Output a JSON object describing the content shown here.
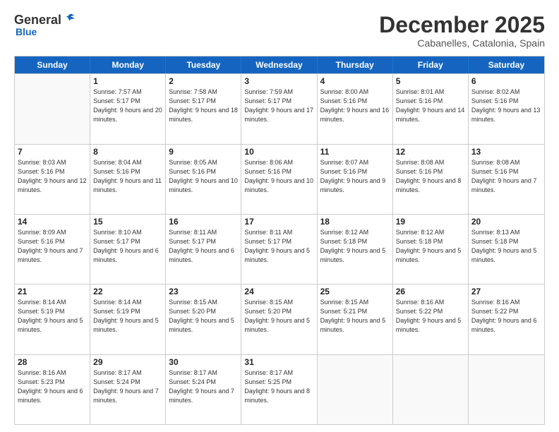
{
  "logo": {
    "general": "General",
    "blue": "Blue"
  },
  "title": "December 2025",
  "location": "Cabanelles, Catalonia, Spain",
  "days_of_week": [
    "Sunday",
    "Monday",
    "Tuesday",
    "Wednesday",
    "Thursday",
    "Friday",
    "Saturday"
  ],
  "weeks": [
    [
      {
        "day": "",
        "info": ""
      },
      {
        "day": "1",
        "info": "Sunrise: 7:57 AM\nSunset: 5:17 PM\nDaylight: 9 hours\nand 20 minutes."
      },
      {
        "day": "2",
        "info": "Sunrise: 7:58 AM\nSunset: 5:17 PM\nDaylight: 9 hours\nand 18 minutes."
      },
      {
        "day": "3",
        "info": "Sunrise: 7:59 AM\nSunset: 5:17 PM\nDaylight: 9 hours\nand 17 minutes."
      },
      {
        "day": "4",
        "info": "Sunrise: 8:00 AM\nSunset: 5:16 PM\nDaylight: 9 hours\nand 16 minutes."
      },
      {
        "day": "5",
        "info": "Sunrise: 8:01 AM\nSunset: 5:16 PM\nDaylight: 9 hours\nand 14 minutes."
      },
      {
        "day": "6",
        "info": "Sunrise: 8:02 AM\nSunset: 5:16 PM\nDaylight: 9 hours\nand 13 minutes."
      }
    ],
    [
      {
        "day": "7",
        "info": "Sunrise: 8:03 AM\nSunset: 5:16 PM\nDaylight: 9 hours\nand 12 minutes."
      },
      {
        "day": "8",
        "info": "Sunrise: 8:04 AM\nSunset: 5:16 PM\nDaylight: 9 hours\nand 11 minutes."
      },
      {
        "day": "9",
        "info": "Sunrise: 8:05 AM\nSunset: 5:16 PM\nDaylight: 9 hours\nand 10 minutes."
      },
      {
        "day": "10",
        "info": "Sunrise: 8:06 AM\nSunset: 5:16 PM\nDaylight: 9 hours\nand 10 minutes."
      },
      {
        "day": "11",
        "info": "Sunrise: 8:07 AM\nSunset: 5:16 PM\nDaylight: 9 hours\nand 9 minutes."
      },
      {
        "day": "12",
        "info": "Sunrise: 8:08 AM\nSunset: 5:16 PM\nDaylight: 9 hours\nand 8 minutes."
      },
      {
        "day": "13",
        "info": "Sunrise: 8:08 AM\nSunset: 5:16 PM\nDaylight: 9 hours\nand 7 minutes."
      }
    ],
    [
      {
        "day": "14",
        "info": "Sunrise: 8:09 AM\nSunset: 5:16 PM\nDaylight: 9 hours\nand 7 minutes."
      },
      {
        "day": "15",
        "info": "Sunrise: 8:10 AM\nSunset: 5:17 PM\nDaylight: 9 hours\nand 6 minutes."
      },
      {
        "day": "16",
        "info": "Sunrise: 8:11 AM\nSunset: 5:17 PM\nDaylight: 9 hours\nand 6 minutes."
      },
      {
        "day": "17",
        "info": "Sunrise: 8:11 AM\nSunset: 5:17 PM\nDaylight: 9 hours\nand 5 minutes."
      },
      {
        "day": "18",
        "info": "Sunrise: 8:12 AM\nSunset: 5:18 PM\nDaylight: 9 hours\nand 5 minutes."
      },
      {
        "day": "19",
        "info": "Sunrise: 8:12 AM\nSunset: 5:18 PM\nDaylight: 9 hours\nand 5 minutes."
      },
      {
        "day": "20",
        "info": "Sunrise: 8:13 AM\nSunset: 5:18 PM\nDaylight: 9 hours\nand 5 minutes."
      }
    ],
    [
      {
        "day": "21",
        "info": "Sunrise: 8:14 AM\nSunset: 5:19 PM\nDaylight: 9 hours\nand 5 minutes."
      },
      {
        "day": "22",
        "info": "Sunrise: 8:14 AM\nSunset: 5:19 PM\nDaylight: 9 hours\nand 5 minutes."
      },
      {
        "day": "23",
        "info": "Sunrise: 8:15 AM\nSunset: 5:20 PM\nDaylight: 9 hours\nand 5 minutes."
      },
      {
        "day": "24",
        "info": "Sunrise: 8:15 AM\nSunset: 5:20 PM\nDaylight: 9 hours\nand 5 minutes."
      },
      {
        "day": "25",
        "info": "Sunrise: 8:15 AM\nSunset: 5:21 PM\nDaylight: 9 hours\nand 5 minutes."
      },
      {
        "day": "26",
        "info": "Sunrise: 8:16 AM\nSunset: 5:22 PM\nDaylight: 9 hours\nand 5 minutes."
      },
      {
        "day": "27",
        "info": "Sunrise: 8:16 AM\nSunset: 5:22 PM\nDaylight: 9 hours\nand 6 minutes."
      }
    ],
    [
      {
        "day": "28",
        "info": "Sunrise: 8:16 AM\nSunset: 5:23 PM\nDaylight: 9 hours\nand 6 minutes."
      },
      {
        "day": "29",
        "info": "Sunrise: 8:17 AM\nSunset: 5:24 PM\nDaylight: 9 hours\nand 7 minutes."
      },
      {
        "day": "30",
        "info": "Sunrise: 8:17 AM\nSunset: 5:24 PM\nDaylight: 9 hours\nand 7 minutes."
      },
      {
        "day": "31",
        "info": "Sunrise: 8:17 AM\nSunset: 5:25 PM\nDaylight: 9 hours\nand 8 minutes."
      },
      {
        "day": "",
        "info": ""
      },
      {
        "day": "",
        "info": ""
      },
      {
        "day": "",
        "info": ""
      }
    ]
  ]
}
